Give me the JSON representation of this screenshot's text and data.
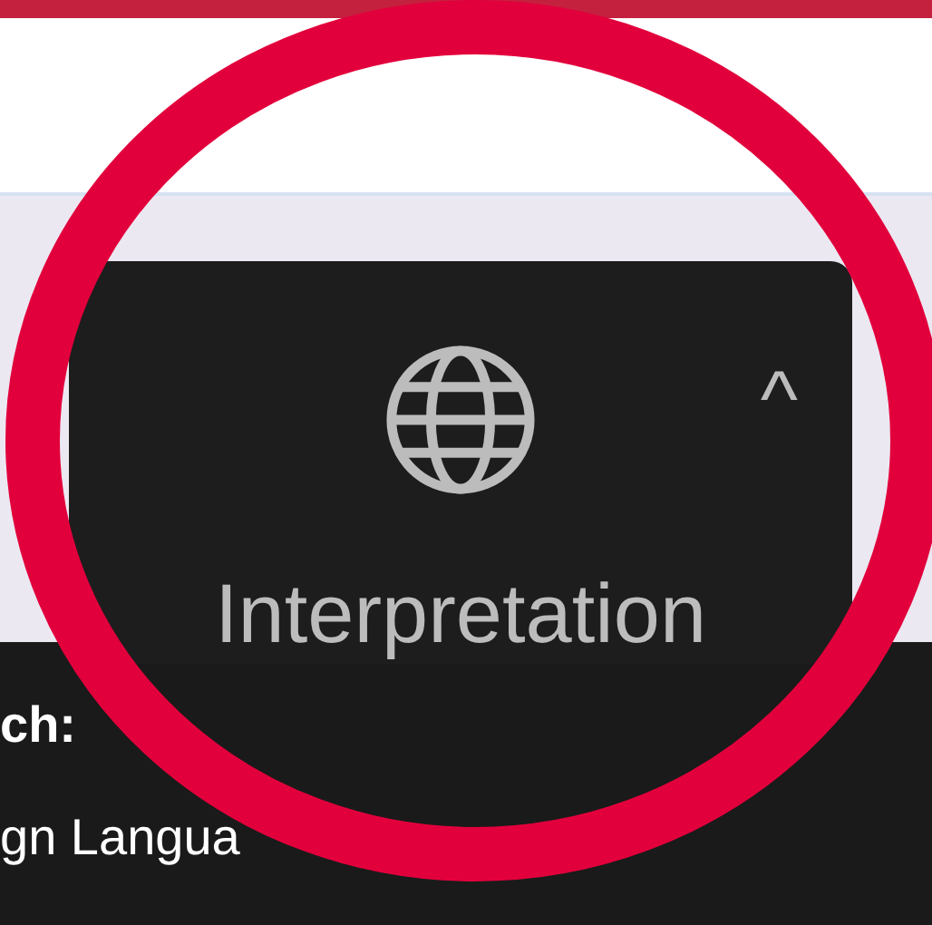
{
  "toolbar_button": {
    "label": "Interpretation",
    "caret": "^"
  },
  "panel": {
    "heading": "ch:",
    "line": "gn Langua"
  }
}
